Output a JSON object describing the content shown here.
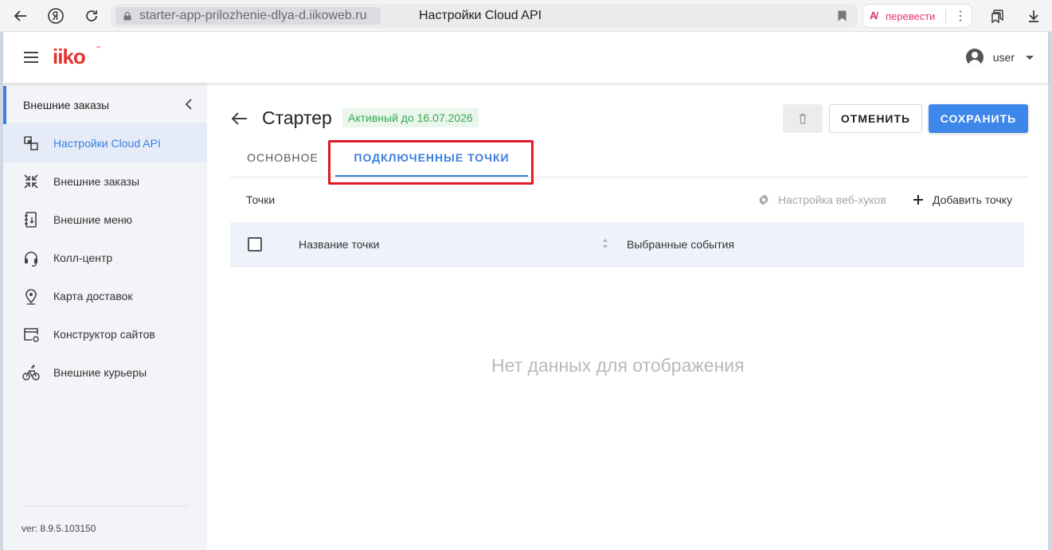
{
  "browser": {
    "url": "starter-app-prilozhenie-dlya-d.iikoweb.ru",
    "page_title": "Настройки Cloud API",
    "translate_label": "перевести",
    "icons": [
      "back-icon",
      "yandex-icon",
      "reload-icon",
      "lock-icon",
      "bookmark-icon",
      "translate-icon",
      "more-icon",
      "collections-icon",
      "download-icon"
    ]
  },
  "header": {
    "logo": "iiko",
    "user_name": "user"
  },
  "sidebar": {
    "title": "Внешние заказы",
    "items": [
      {
        "label": "Настройки Cloud API",
        "icon": "cloud-api-icon",
        "active": true
      },
      {
        "label": "Внешние заказы",
        "icon": "external-orders-icon",
        "active": false
      },
      {
        "label": "Внешние меню",
        "icon": "external-menu-icon",
        "active": false
      },
      {
        "label": "Колл-центр",
        "icon": "headset-icon",
        "active": false
      },
      {
        "label": "Карта доставок",
        "icon": "map-pin-icon",
        "active": false
      },
      {
        "label": "Конструктор сайтов",
        "icon": "site-builder-icon",
        "active": false
      },
      {
        "label": "Внешние курьеры",
        "icon": "bicycle-icon",
        "active": false
      }
    ],
    "version": "ver: 8.9.5.103150"
  },
  "main": {
    "title": "Стартер",
    "status": "Активный до 16.07.2026",
    "buttons": {
      "cancel": "ОТМЕНИТЬ",
      "save": "СОХРАНИТЬ"
    },
    "tabs": [
      {
        "label": "ОСНОВНОЕ",
        "active": false
      },
      {
        "label": "ПОДКЛЮЧЕННЫЕ ТОЧКИ",
        "active": true
      }
    ],
    "toolbar": {
      "label": "Точки",
      "webhooks": "Настройка веб-хуков",
      "add_point": "Добавить точку"
    },
    "table": {
      "columns": [
        "Название точки",
        "Выбранные события"
      ],
      "rows": []
    },
    "empty_message": "Нет данных для отображения"
  },
  "colors": {
    "accent": "#3b7fe0",
    "save_button": "#3d86ea",
    "status_green": "#36a852",
    "highlight_red": "#e01b24",
    "logo_red": "#e5322d"
  }
}
